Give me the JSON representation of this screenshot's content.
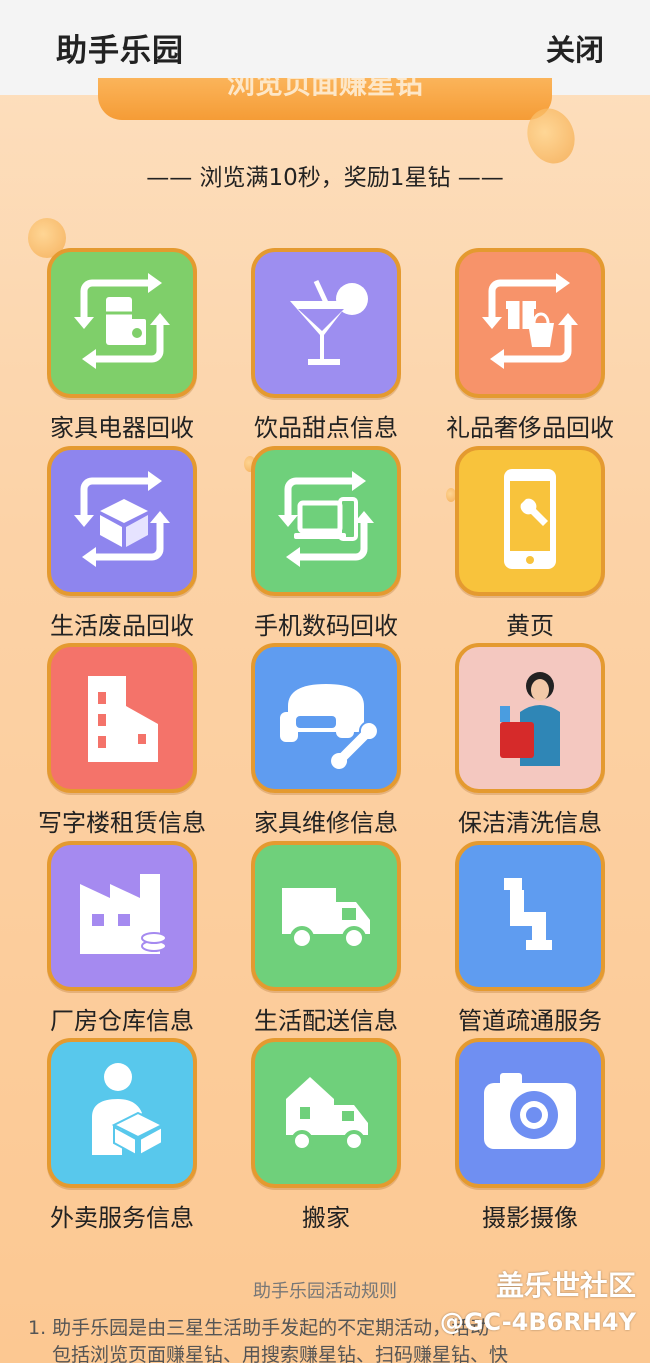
{
  "header": {
    "title": "助手乐园",
    "close_label": "关闭"
  },
  "banner": {
    "text": "浏览页面赚星钻"
  },
  "subtitle": "—— 浏览满10秒，奖励1星钻 ——",
  "services": [
    {
      "label": "家具电器回收",
      "icon": "appliance-recycle-icon",
      "color": "#7fcf6a"
    },
    {
      "label": "饮品甜点信息",
      "icon": "drink-cocktail-icon",
      "color": "#9d8ef0"
    },
    {
      "label": "礼品奢侈品回收",
      "icon": "gift-bag-recycle-icon",
      "color": "#f7936a"
    },
    {
      "label": "生活废品回收",
      "icon": "box-recycle-icon",
      "color": "#8e85ee"
    },
    {
      "label": "手机数码回收",
      "icon": "devices-recycle-icon",
      "color": "#6fd07b"
    },
    {
      "label": "黄页",
      "icon": "phone-wrench-icon",
      "color": "#f8c33c"
    },
    {
      "label": "写字楼租赁信息",
      "icon": "office-building-icon",
      "color": "#f4736a"
    },
    {
      "label": "家具维修信息",
      "icon": "sofa-repair-icon",
      "color": "#5f9cf0"
    },
    {
      "label": "保洁清洗信息",
      "icon": "cleaner-woman-icon",
      "color": "#f4c8c0"
    },
    {
      "label": "厂房仓库信息",
      "icon": "factory-icon",
      "color": "#a58af0"
    },
    {
      "label": "生活配送信息",
      "icon": "delivery-truck-icon",
      "color": "#6fd07b"
    },
    {
      "label": "管道疏通服务",
      "icon": "pipe-icon",
      "color": "#5f9cf0"
    },
    {
      "label": "外卖服务信息",
      "icon": "courier-box-icon",
      "color": "#58c8ec"
    },
    {
      "label": "搬家",
      "icon": "moving-truck-icon",
      "color": "#6fd07b"
    },
    {
      "label": "摄影摄像",
      "icon": "camera-icon",
      "color": "#6f8ff2"
    }
  ],
  "rules": {
    "title": "助手乐园活动规则",
    "line1": "1. 助手乐园是由三星生活助手发起的不定期活动，活动",
    "line2": "包括浏览页面赚星钻、用搜索赚星钻、扫码赚星钻、快"
  },
  "watermark": {
    "site": "盖乐世社区",
    "user": "@GC-4B6RH4Y"
  }
}
